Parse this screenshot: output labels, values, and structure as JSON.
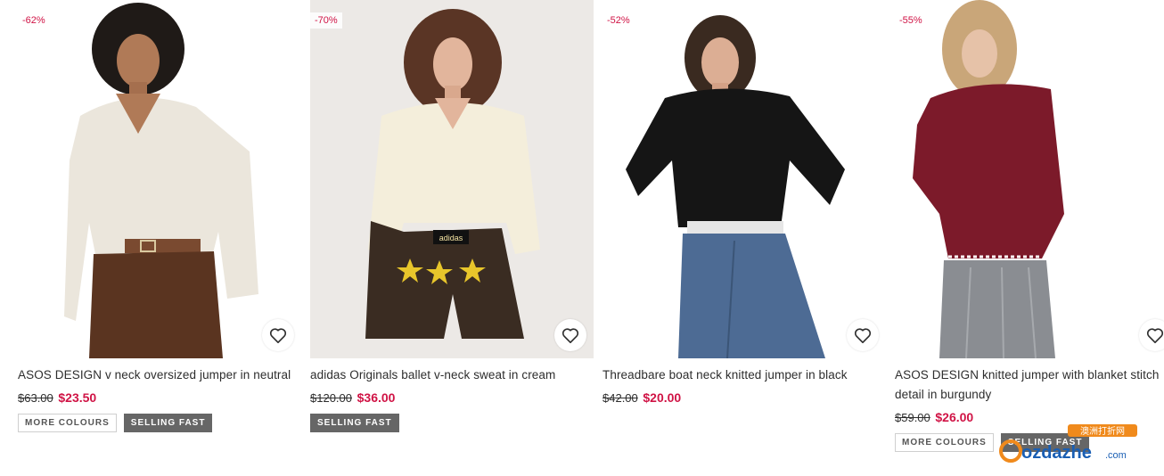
{
  "products": [
    {
      "discount": "-62%",
      "title": "ASOS DESIGN v neck oversized jumper in neutral",
      "was_price": "$63.00",
      "now_price": "$23.50",
      "tags": [
        "MORE COLOURS",
        "SELLING FAST"
      ]
    },
    {
      "discount": "-70%",
      "title": "adidas Originals ballet v-neck sweat in cream",
      "was_price": "$120.00",
      "now_price": "$36.00",
      "tags": [
        "SELLING FAST"
      ]
    },
    {
      "discount": "-52%",
      "title": "Threadbare boat neck knitted jumper in black",
      "was_price": "$42.00",
      "now_price": "$20.00",
      "tags": []
    },
    {
      "discount": "-55%",
      "title": "ASOS DESIGN knitted jumper with blanket stitch detail in burgundy",
      "was_price": "$59.00",
      "now_price": "$26.00",
      "tags": [
        "MORE COLOURS",
        "SELLING FAST"
      ]
    }
  ],
  "watermark": {
    "top": "澳洲打折网",
    "brand": "ozdazhe",
    "suffix": ".com"
  },
  "colors": {
    "sale_red": "#d01345",
    "tag_dark": "#666666"
  }
}
